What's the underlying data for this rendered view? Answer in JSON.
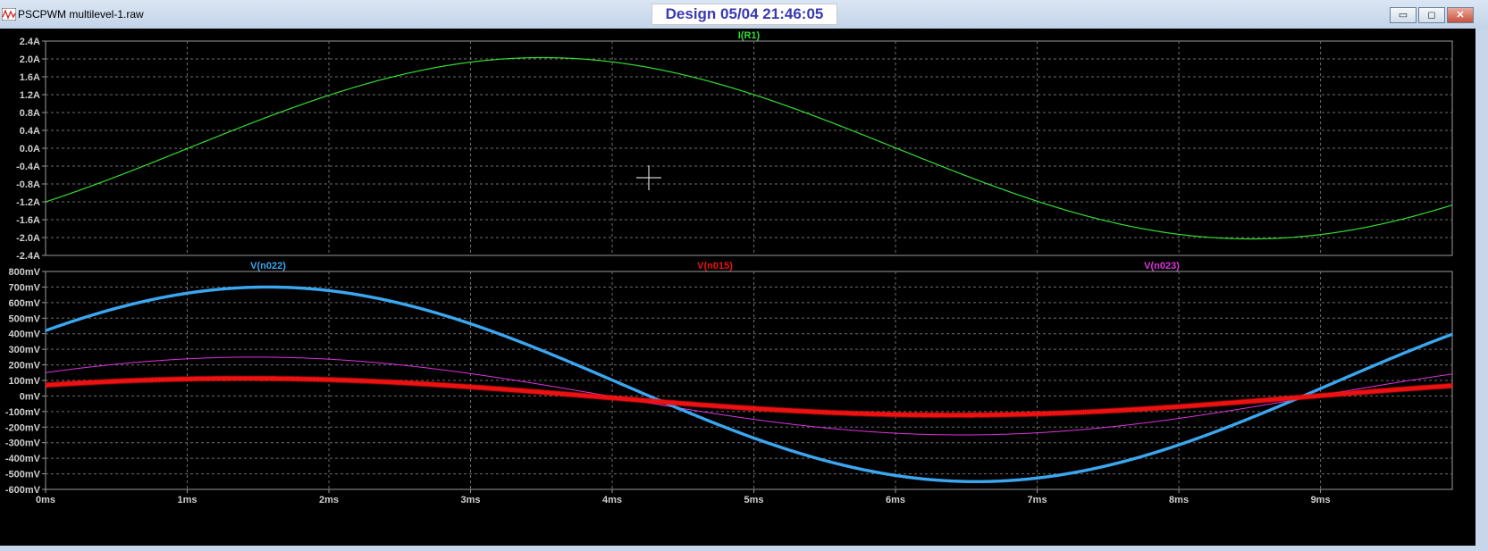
{
  "window": {
    "title": "PSCPWM multilevel-1.raw",
    "center_title": "Design  05/04  21:46:05",
    "buttons": {
      "minimize": "▭",
      "maximize": "◻",
      "close": "✕"
    }
  },
  "chart_data": [
    {
      "type": "line",
      "pane": "upper",
      "ylabel": "I(R1)",
      "ylim": [
        -2.4,
        2.4
      ],
      "yticks": [
        2.4,
        2.0,
        1.6,
        1.2,
        0.8,
        0.4,
        0.0,
        -0.4,
        -0.8,
        -1.2,
        -1.6,
        -2.0,
        -2.4
      ],
      "ytick_labels": [
        "2.4A",
        "2.0A",
        "1.6A",
        "1.2A",
        "0.8A",
        "0.4A",
        "0.0A",
        "-0.4A",
        "-0.8A",
        "-1.2A",
        "-1.6A",
        "-2.0A",
        "-2.4A"
      ],
      "xlim_ms": [
        0,
        9.93
      ],
      "grid": true,
      "series": [
        {
          "name": "I(R1)",
          "color": "#33dd33",
          "amplitude": 2.03,
          "offset": 0.0,
          "frequency_hz": 100,
          "value_at_0ms": -1.2
        }
      ]
    },
    {
      "type": "line",
      "pane": "lower",
      "ylim": [
        -600,
        800
      ],
      "yticks": [
        800,
        700,
        600,
        500,
        400,
        300,
        200,
        100,
        0,
        -100,
        -200,
        -300,
        -400,
        -500,
        -600
      ],
      "ytick_labels": [
        "800mV",
        "700mV",
        "600mV",
        "500mV",
        "400mV",
        "300mV",
        "200mV",
        "100mV",
        "0mV",
        "-100mV",
        "-200mV",
        "-300mV",
        "-400mV",
        "-500mV",
        "-600mV"
      ],
      "xlim_ms": [
        0,
        9.93
      ],
      "xticks_ms": [
        0,
        1,
        2,
        3,
        4,
        5,
        6,
        7,
        8,
        9
      ],
      "xtick_labels": [
        "0ms",
        "1ms",
        "2ms",
        "3ms",
        "4ms",
        "5ms",
        "6ms",
        "7ms",
        "8ms",
        "9ms"
      ],
      "grid": true,
      "series": [
        {
          "name": "V(n022)",
          "color": "#3ba7f0",
          "amplitude_mV": 625,
          "offset_mV": 75,
          "frequency_hz": 100,
          "value_at_0ms_mV": 420,
          "ripple_mV": 18
        },
        {
          "name": "V(n015)",
          "color": "#ee1111",
          "amplitude_mV": 118,
          "offset_mV": -5,
          "frequency_hz": 100,
          "value_at_0ms_mV": 70,
          "ripple_mV": 10
        },
        {
          "name": "V(n023)",
          "color": "#dd33dd",
          "amplitude_mV": 250,
          "offset_mV": 0,
          "frequency_hz": 100,
          "value_at_0ms_mV": 150,
          "ripple_mV": 0
        }
      ]
    }
  ]
}
